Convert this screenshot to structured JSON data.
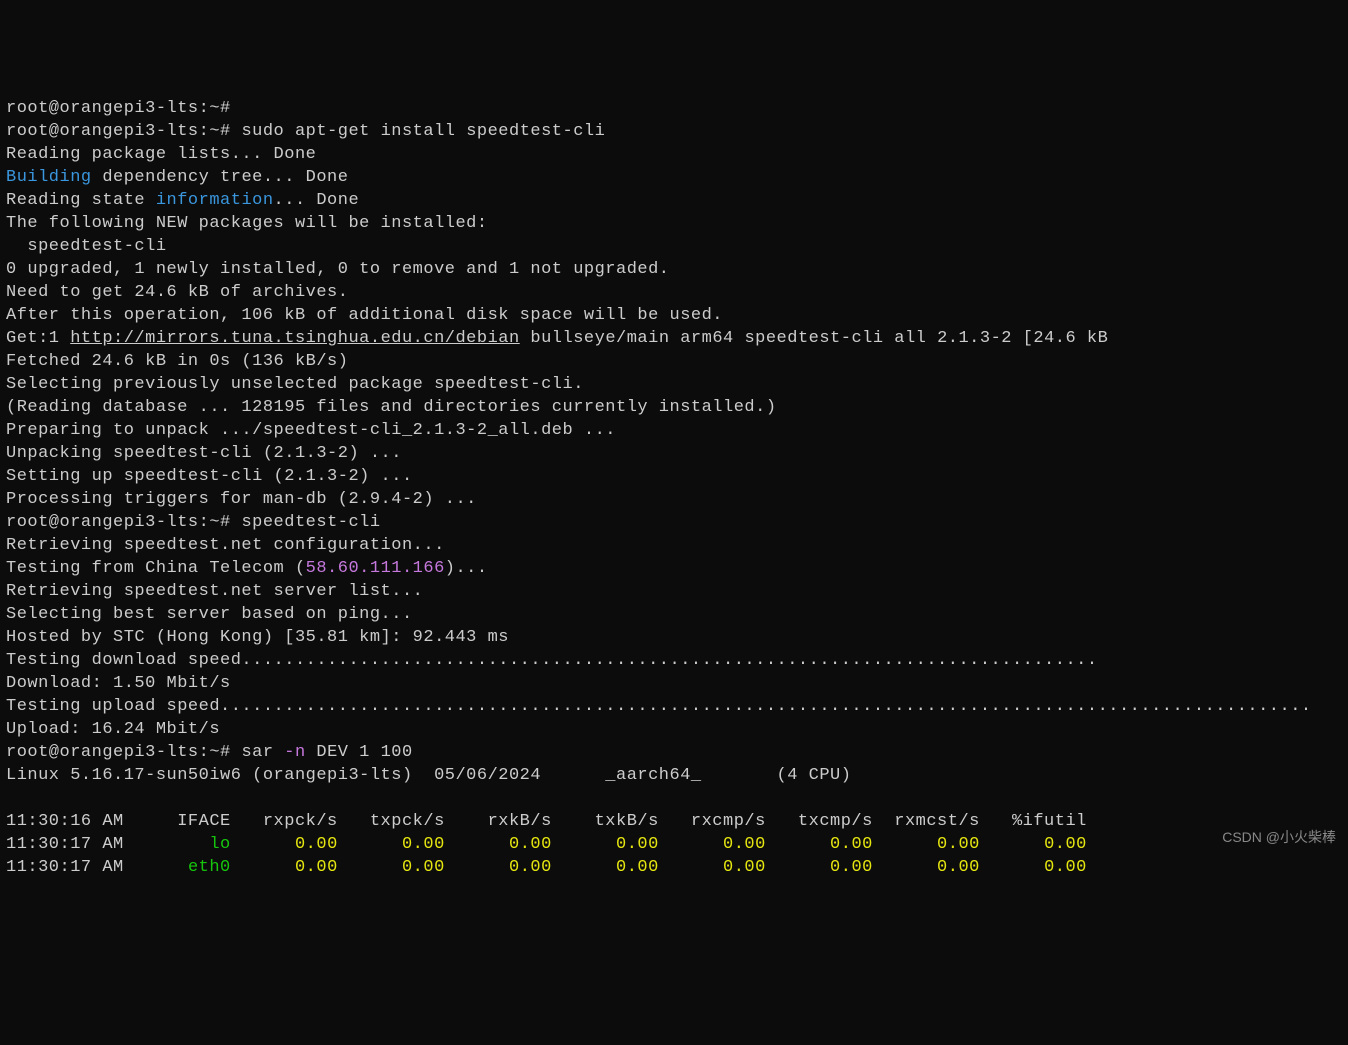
{
  "prompt": "root@orangepi3-lts:~#",
  "cmd_install": "sudo apt-get install speedtest-cli",
  "l1": "Reading package lists... Done",
  "l2a": "Building",
  "l2b": " dependency tree... Done",
  "l3a": "Reading state ",
  "l3b": "information",
  "l3c": "... Done",
  "l4": "The following NEW packages will be installed:",
  "l5": "  speedtest-cli",
  "l6": "0 upgraded, 1 newly installed, 0 to remove and 1 not upgraded.",
  "l7": "Need to get 24.6 kB of archives.",
  "l8": "After this operation, 106 kB of additional disk space will be used.",
  "l9a": "Get:1 ",
  "l9url": "http://mirrors.tuna.tsinghua.edu.cn/debian",
  "l9b": " bullseye/main arm64 speedtest-cli all 2.1.3-2 [24.6 kB",
  "l10": "Fetched 24.6 kB in 0s (136 kB/s)",
  "l11": "Selecting previously unselected package speedtest-cli.",
  "l12": "(Reading database ... 128195 files and directories currently installed.)",
  "l13": "Preparing to unpack .../speedtest-cli_2.1.3-2_all.deb ...",
  "l14": "Unpacking speedtest-cli (2.1.3-2) ...",
  "l15": "Setting up speedtest-cli (2.1.3-2) ...",
  "l16": "Processing triggers for man-db (2.9.4-2) ...",
  "cmd_speedtest": "speedtest-cli",
  "l17": "Retrieving speedtest.net configuration...",
  "l18a": "Testing from China Telecom (",
  "l18ip": "58.60.111.166",
  "l18b": ")...",
  "l19": "Retrieving speedtest.net server list...",
  "l20": "Selecting best server based on ping...",
  "l21": "Hosted by STC (Hong Kong) [35.81 km]: 92.443 ms",
  "l22": "Testing download speed................................................................................",
  "l23": "Download: 1.50 Mbit/s",
  "l24": "Testing upload speed......................................................................................................",
  "l25": "Upload: 16.24 Mbit/s",
  "cmd_sar_a": "sar ",
  "cmd_sar_b": "-n",
  "cmd_sar_c": " DEV 1 100",
  "l26": "Linux 5.16.17-sun50iw6 (orangepi3-lts)  05/06/2024      _aarch64_       (4 CPU)",
  "blank": "",
  "table": {
    "headers": "11:30:16 AM     IFACE   rxpck/s   txpck/s    rxkB/s    txkB/s   rxcmp/s   txcmp/s  rxmcst/s   %ifutil",
    "row1_time": "11:30:17 AM        ",
    "row1_iface": "lo",
    "row1_vals": "      0.00      0.00      0.00      0.00      0.00      0.00      0.00      0.00",
    "row2_time": "11:30:17 AM      ",
    "row2_iface": "eth0",
    "row2_vals": "      0.00      0.00      0.00      0.00      0.00      0.00      0.00      0.00"
  },
  "watermark": "CSDN @小火柴棒"
}
